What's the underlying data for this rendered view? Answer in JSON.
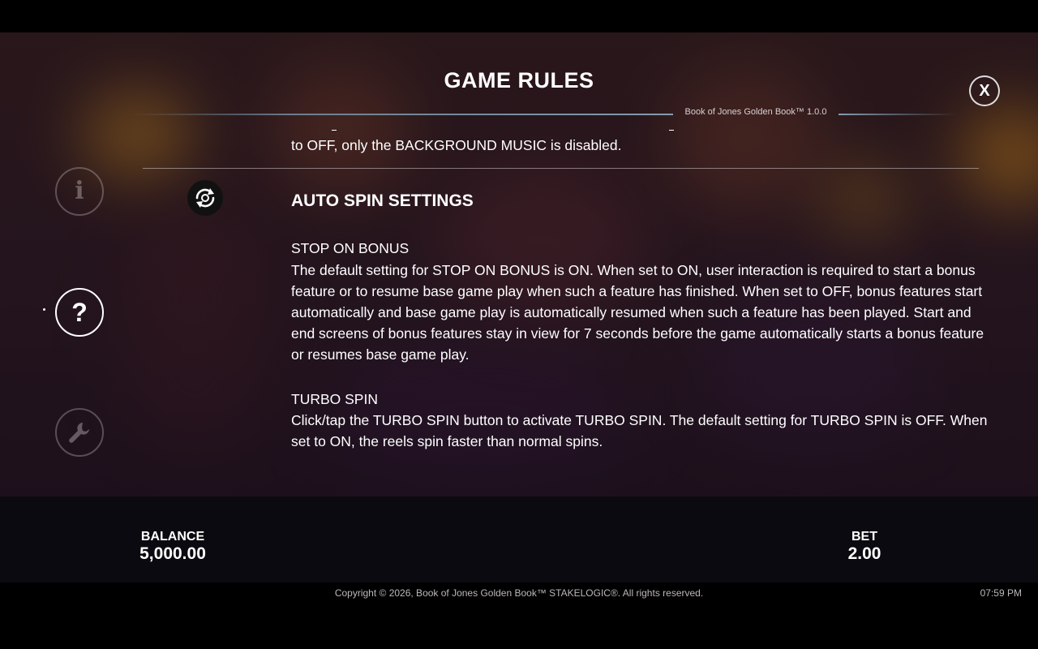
{
  "header": {
    "title": "GAME RULES",
    "version": "Book of Jones Golden Book™ 1.0.0",
    "close_label": "X"
  },
  "content": {
    "previous_tail": "to OFF, only the BACKGROUND MUSIC is disabled.",
    "section_heading": "AUTO SPIN SETTINGS",
    "stop_on_bonus": {
      "heading": "STOP ON BONUS",
      "body": "The default setting for STOP ON BONUS is ON. When set to ON, user interaction is required to start a bonus feature or to resume base game play when such a feature has finished. When set to OFF, bonus features start automatically and base game play is automatically resumed when such a feature has been played. Start and end screens of bonus features stay in view for 7 seconds before the game automatically starts a bonus feature or resumes base game play."
    },
    "turbo_spin": {
      "heading": "TURBO SPIN",
      "body": "Click/tap the TURBO SPIN button to activate TURBO SPIN. The default setting for TURBO SPIN is OFF. When set to ON, the reels spin faster than normal spins."
    }
  },
  "sidebar": {
    "items": [
      {
        "icon": "info-icon",
        "label": "i",
        "active": false
      },
      {
        "icon": "help-icon",
        "label": "?",
        "active": true
      },
      {
        "icon": "wrench-icon",
        "label": "",
        "active": false
      }
    ]
  },
  "info_bar": {
    "balance_label": "BALANCE",
    "balance_value": "5,000.00",
    "bet_label": "BET",
    "bet_value": "2.00"
  },
  "footer": {
    "copyright": "Copyright © 2026, Book of Jones Golden Book™ STAKELOGIC®. All rights reserved.",
    "time": "07:59 PM"
  },
  "colors": {
    "background": "#000000",
    "info_bar": "#0b0a10",
    "text": "#ffffff"
  }
}
